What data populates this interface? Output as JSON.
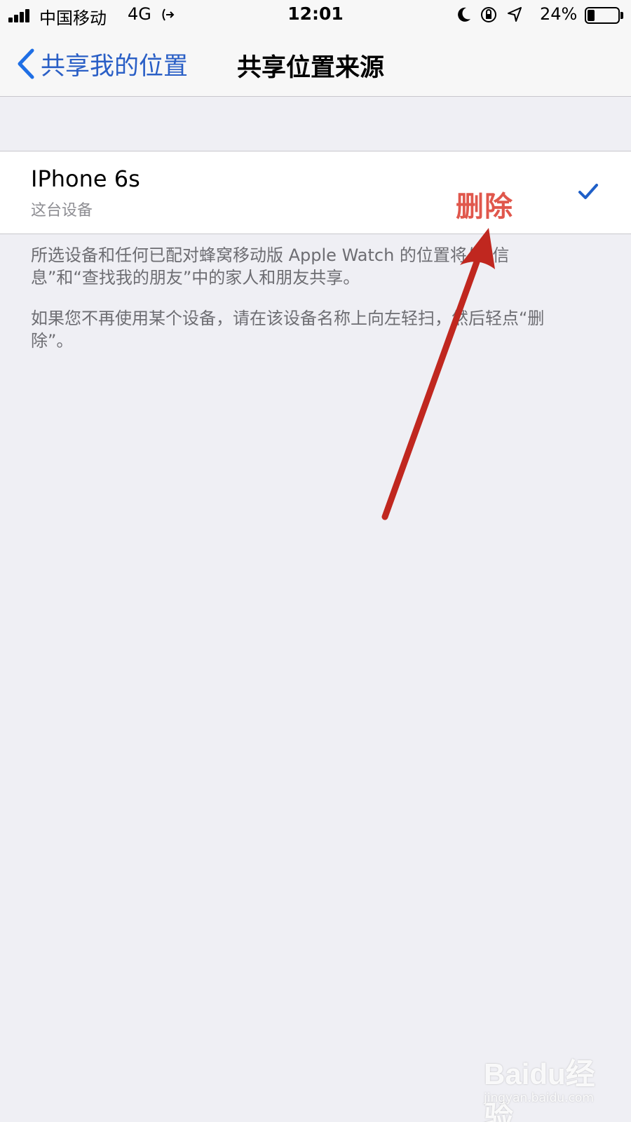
{
  "status_bar": {
    "carrier": "中国移动",
    "network": "4G",
    "time": "12:01",
    "battery_percent": "24%",
    "battery_level": 0.24
  },
  "nav": {
    "back_label": "共享我的位置",
    "title": "共享位置来源"
  },
  "device": {
    "name": "IPhone 6s",
    "subtitle": "这台设备",
    "selected": true
  },
  "annotation": {
    "label": "删除",
    "color": "#c0271f"
  },
  "footer": {
    "paragraph_1": "所选设备和任何已配对蜂窝移动版 Apple Watch 的位置将与“信息”和“查找我的朋友”中的家人和朋友共享。",
    "paragraph_2": "如果您不再使用某个设备，请在该设备名称上向左轻扫，然后轻点“删除”。"
  },
  "watermark": {
    "brand": "Baidu经验",
    "url": "jingyan.baidu.com"
  },
  "colors": {
    "accent": "#1f6fe5",
    "background": "#efeff4"
  }
}
